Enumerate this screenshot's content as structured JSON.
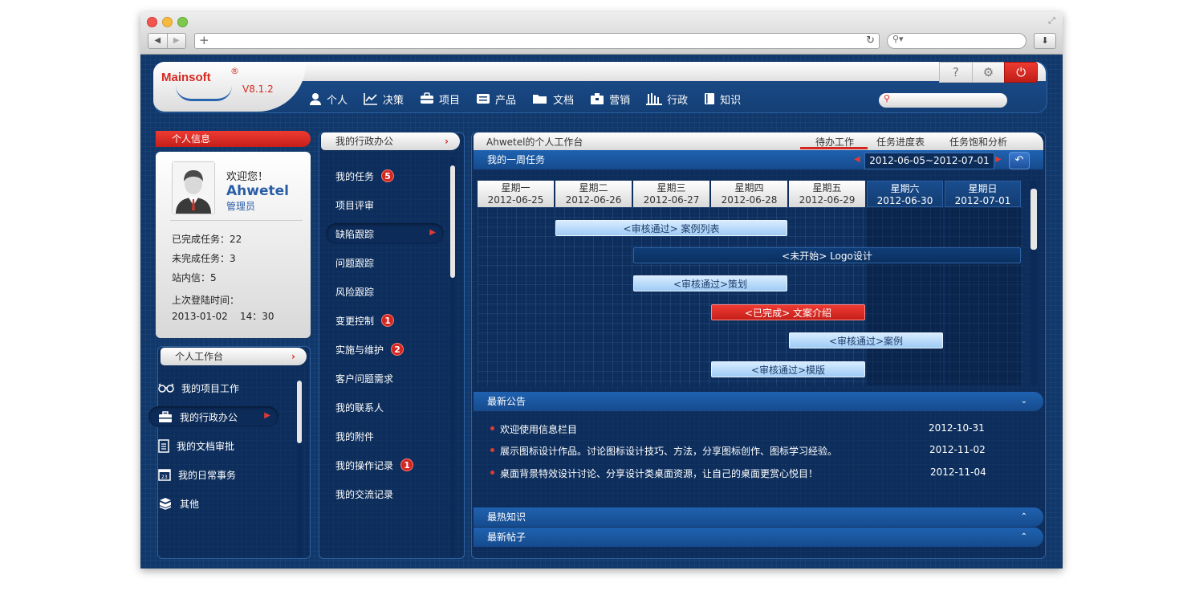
{
  "app": {
    "logo": "Mainsoft",
    "logo_reg": "®",
    "version": "V8.1.2",
    "tools": {
      "help": "?",
      "settings": "⚙",
      "power": "⏻"
    }
  },
  "nav": [
    {
      "label": "个人",
      "icon": "user-icon"
    },
    {
      "label": "决策",
      "icon": "chart-icon"
    },
    {
      "label": "项目",
      "icon": "briefcase-icon"
    },
    {
      "label": "产品",
      "icon": "product-icon"
    },
    {
      "label": "文档",
      "icon": "folder-icon"
    },
    {
      "label": "营销",
      "icon": "marketing-icon"
    },
    {
      "label": "行政",
      "icon": "building-icon"
    },
    {
      "label": "知识",
      "icon": "book-icon"
    }
  ],
  "profile": {
    "section_title": "个人信息",
    "welcome": "欢迎您！",
    "name": "Ahwetel",
    "role": "管理员",
    "stats": [
      "已完成任务：22",
      "未完成任务：3",
      "站内信：5"
    ],
    "last_login_label": "上次登陆时间：",
    "last_login_value": "2013-01-02    14：30"
  },
  "workspace": {
    "title": "个人工作台",
    "arrow": "›",
    "items": [
      {
        "label": "我的项目工作",
        "icon": "glasses-icon"
      },
      {
        "label": "我的行政办公",
        "icon": "toolbox-icon",
        "active": true
      },
      {
        "label": "我的文档审批",
        "icon": "document-icon"
      },
      {
        "label": "我的日常事务",
        "icon": "calendar-icon"
      },
      {
        "label": "其他",
        "icon": "boxes-icon"
      }
    ]
  },
  "admin": {
    "title": "我的行政办公",
    "arrow": "›",
    "items": [
      {
        "label": "我的任务",
        "badge": "5"
      },
      {
        "label": "项目评审"
      },
      {
        "label": "缺陷跟踪",
        "active": true
      },
      {
        "label": "问题跟踪"
      },
      {
        "label": "风险跟踪"
      },
      {
        "label": "变更控制",
        "badge": "1"
      },
      {
        "label": "实施与维护",
        "badge": "2"
      },
      {
        "label": "客户问题需求"
      },
      {
        "label": "我的联系人"
      },
      {
        "label": "我的附件"
      },
      {
        "label": "我的操作记录",
        "badge": "1"
      },
      {
        "label": "我的交流记录"
      }
    ]
  },
  "workbench": {
    "title": "Ahwetel的个人工作台",
    "tabs": [
      "待办工作",
      "任务进度表",
      "任务饱和分析"
    ],
    "week_title": "我的一周任务",
    "date_range": "2012-06-05~2012-07-01",
    "days": [
      {
        "name": "星期一",
        "date": "2012-06-25",
        "weekend": false
      },
      {
        "name": "星期二",
        "date": "2012-06-26",
        "weekend": false
      },
      {
        "name": "星期三",
        "date": "2012-06-27",
        "weekend": false
      },
      {
        "name": "星期四",
        "date": "2012-06-28",
        "weekend": false
      },
      {
        "name": "星期五",
        "date": "2012-06-29",
        "weekend": false
      },
      {
        "name": "星期六",
        "date": "2012-06-30",
        "weekend": true
      },
      {
        "name": "星期日",
        "date": "2012-07-01",
        "weekend": true
      }
    ],
    "tasks": [
      {
        "label": "<审核通过> 案例列表",
        "start": 1,
        "span": 3,
        "style": "light"
      },
      {
        "label": "<未开始> Logo设计",
        "start": 2,
        "span": 5,
        "style": "dark"
      },
      {
        "label": "<审核通过>策划",
        "start": 2,
        "span": 2,
        "style": "light"
      },
      {
        "label": "<已完成> 文案介绍",
        "start": 3,
        "span": 2,
        "style": "red"
      },
      {
        "label": "<审核通过>案例",
        "start": 4,
        "span": 2,
        "style": "light"
      },
      {
        "label": "<审核通过>模版",
        "start": 3,
        "span": 2,
        "style": "light"
      }
    ]
  },
  "announcements": {
    "title": "最新公告",
    "chevron": "⌄",
    "items": [
      {
        "text": "欢迎使用信息栏目",
        "date": "2012-10-31"
      },
      {
        "text": "展示图标设计作品。讨论图标设计技巧、方法，分享图标创作、图标学习经验。",
        "date": "2012-11-02"
      },
      {
        "text": "桌面背景特效设计讨论、分享设计类桌面资源，让自己的桌面更赏心悦目！",
        "date": "2012-11-04"
      }
    ]
  },
  "hot_knowledge": {
    "title": "最热知识",
    "chevron": "⌃"
  },
  "latest_posts": {
    "title": "最新帖子",
    "chevron": "⌃"
  },
  "colors": {
    "accent_red": "#d42720",
    "brand_blue": "#2a5ea6",
    "background": "#11386b"
  }
}
